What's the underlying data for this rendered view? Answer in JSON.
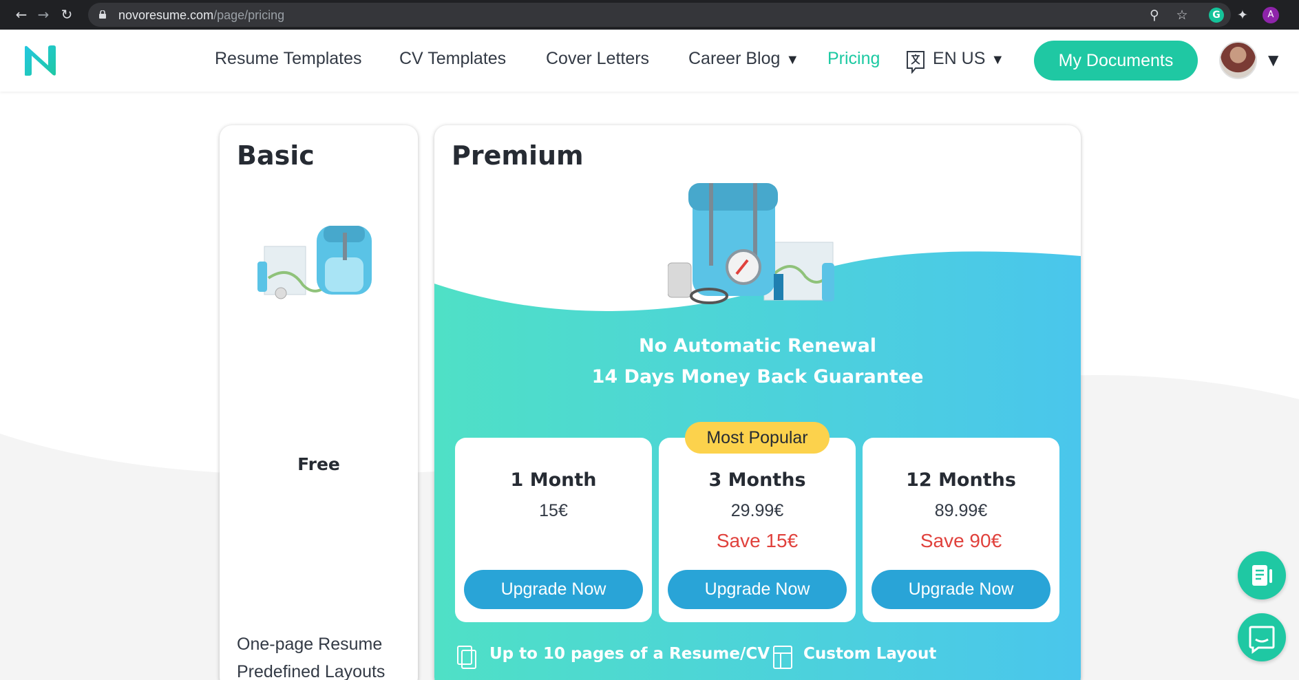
{
  "browser": {
    "url_domain": "novoresume.com",
    "url_path": "/page/pricing",
    "icons": [
      "back-arrow-icon",
      "forward-arrow-icon",
      "reload-icon",
      "lock-icon",
      "zoom-icon",
      "star-icon",
      "grammarly-icon",
      "extensions-icon",
      "profile-icon"
    ],
    "grammarly_letter": "G",
    "profile_letter": "A"
  },
  "header": {
    "nav": [
      "Resume Templates",
      "CV Templates",
      "Cover Letters",
      "Career Blog",
      "Pricing"
    ],
    "language": "EN US",
    "my_documents": "My Documents",
    "active_item": "Pricing",
    "accent_color": "#1fc8a3"
  },
  "basic": {
    "title": "Basic",
    "price": "Free",
    "features": [
      "One-page Resume",
      "Predefined Layouts"
    ]
  },
  "premium": {
    "title": "Premium",
    "guarantee_line1": "No Automatic Renewal",
    "guarantee_line2": "14 Days Money Back Guarantee",
    "badge": "Most Popular",
    "plans": [
      {
        "name": "1 Month",
        "price": "15€",
        "save": "",
        "cta": "Upgrade Now"
      },
      {
        "name": "3 Months",
        "price": "29.99€",
        "save": "Save 15€",
        "cta": "Upgrade Now"
      },
      {
        "name": "12 Months",
        "price": "89.99€",
        "save": "Save 90€",
        "cta": "Upgrade Now"
      }
    ],
    "features": [
      "Up to 10 pages of a Resume/CV",
      "Custom Layout"
    ],
    "gradient": [
      "#4fe0c6",
      "#4ac6ec"
    ],
    "save_color": "#e0413c",
    "button_color": "#29a4d7",
    "badge_color": "#fcd24c"
  },
  "floating": [
    "document-icon",
    "chat-icon"
  ]
}
